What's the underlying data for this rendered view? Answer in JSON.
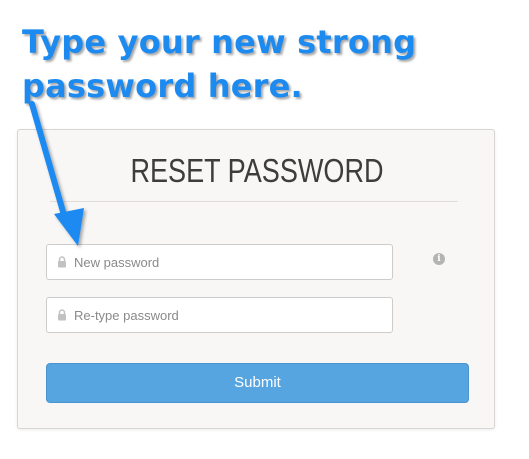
{
  "annotation": {
    "line1": "Type your new strong",
    "line2": "password here.",
    "color": "#1d8af0"
  },
  "form": {
    "title": "RESET PASSWORD",
    "new_password": {
      "value": "",
      "placeholder": "New password",
      "icon": "lock-icon"
    },
    "retype_password": {
      "value": "",
      "placeholder": "Re-type password",
      "icon": "lock-icon"
    },
    "info_icon": "info-icon",
    "info_glyph": "i",
    "submit_label": "Submit"
  },
  "colors": {
    "button": "#56a4e0",
    "card_background": "#f8f7f5",
    "title": "#3d3d3d"
  }
}
